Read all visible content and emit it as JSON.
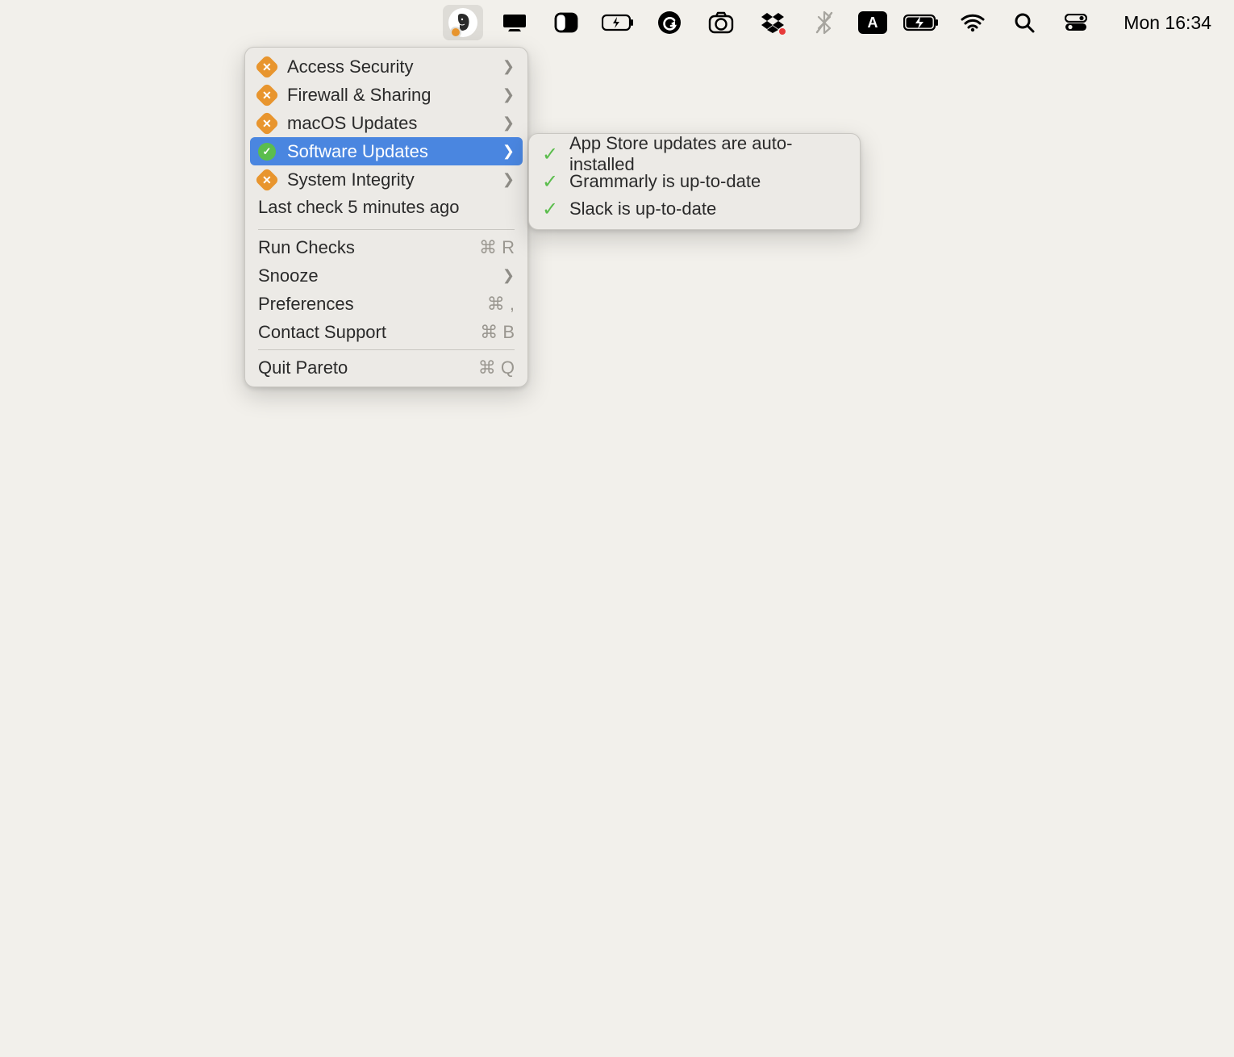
{
  "menubar": {
    "clock": "Mon 16:34"
  },
  "menu": {
    "items": [
      {
        "label": "Access Security",
        "status": "orange",
        "hasSubmenu": true,
        "highlighted": false
      },
      {
        "label": "Firewall & Sharing",
        "status": "orange",
        "hasSubmenu": true,
        "highlighted": false
      },
      {
        "label": "macOS Updates",
        "status": "orange",
        "hasSubmenu": true,
        "highlighted": false
      },
      {
        "label": "Software Updates",
        "status": "green",
        "hasSubmenu": true,
        "highlighted": true
      },
      {
        "label": "System Integrity",
        "status": "orange",
        "hasSubmenu": true,
        "highlighted": false
      }
    ],
    "last_check": "Last check 5 minutes ago",
    "actions": [
      {
        "label": "Run Checks",
        "shortcut": "⌘ R",
        "hasSubmenu": false
      },
      {
        "label": "Snooze",
        "shortcut": "",
        "hasSubmenu": true
      },
      {
        "label": "Preferences",
        "shortcut": "⌘ ,",
        "hasSubmenu": false
      },
      {
        "label": "Contact Support",
        "shortcut": "⌘ B",
        "hasSubmenu": false
      }
    ],
    "quit": {
      "label": "Quit Pareto",
      "shortcut": "⌘ Q"
    }
  },
  "submenu": {
    "items": [
      {
        "label": "App Store updates are auto-installed"
      },
      {
        "label": "Grammarly is up-to-date"
      },
      {
        "label": "Slack is up-to-date"
      }
    ]
  }
}
